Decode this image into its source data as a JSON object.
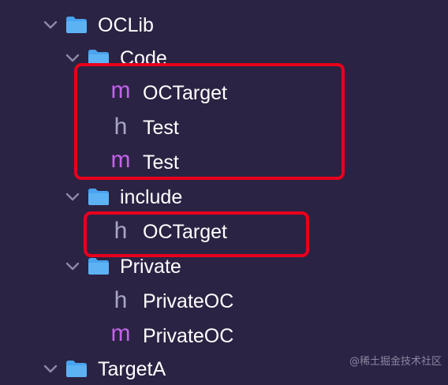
{
  "theme": {
    "background": "#2b2343",
    "folder_color": "#4aa3ee",
    "m_icon_color": "#c562ee",
    "h_icon_color": "#a9a6c4",
    "highlight_color": "#e8001c"
  },
  "tree": {
    "oclib": {
      "label": "OCLib",
      "icon": "folder-icon",
      "expanded": true
    },
    "code": {
      "label": "Code",
      "icon": "folder-icon",
      "expanded": true
    },
    "code_files": [
      {
        "glyph": "m",
        "label": "OCTarget",
        "icon": "objc-source-icon"
      },
      {
        "glyph": "h",
        "label": "Test",
        "icon": "header-file-icon"
      },
      {
        "glyph": "m",
        "label": "Test",
        "icon": "objc-source-icon"
      }
    ],
    "include": {
      "label": "include",
      "icon": "folder-icon",
      "expanded": true
    },
    "include_files": [
      {
        "glyph": "h",
        "label": "OCTarget",
        "icon": "header-file-icon"
      }
    ],
    "private": {
      "label": "Private",
      "icon": "folder-icon",
      "expanded": true
    },
    "private_files": [
      {
        "glyph": "h",
        "label": "PrivateOC",
        "icon": "header-file-icon"
      },
      {
        "glyph": "m",
        "label": "PrivateOC",
        "icon": "objc-source-icon"
      }
    ],
    "targeta": {
      "label": "TargetA",
      "icon": "folder-icon",
      "expanded": true
    }
  },
  "watermark": "@稀土掘金技术社区"
}
